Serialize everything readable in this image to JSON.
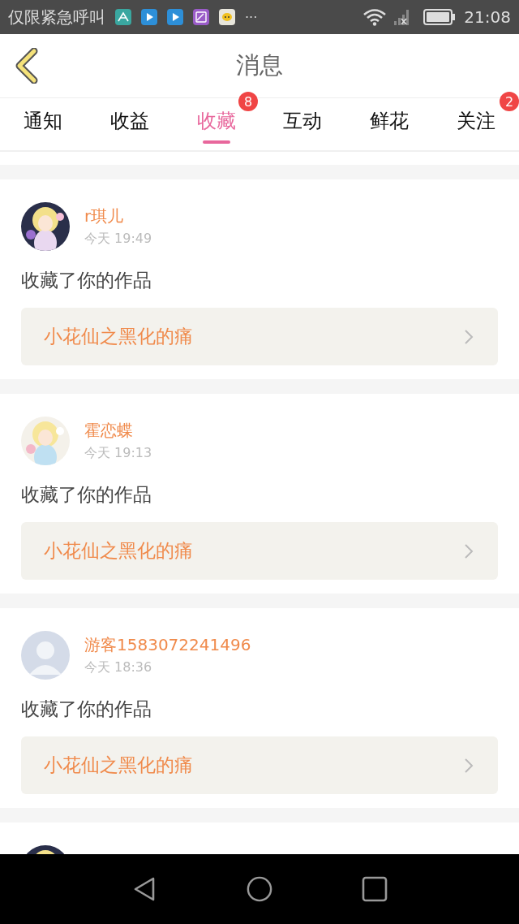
{
  "status_bar": {
    "notice": "仅限紧急呼叫",
    "more": "···",
    "time": "21:08"
  },
  "header": {
    "title": "消息"
  },
  "tabs": [
    {
      "label": "通知",
      "selected": false
    },
    {
      "label": "收益",
      "selected": false
    },
    {
      "label": "收藏",
      "selected": true,
      "badge": "8"
    },
    {
      "label": "互动",
      "selected": false
    },
    {
      "label": "鲜花",
      "selected": false
    },
    {
      "label": "关注",
      "selected": false,
      "badge": "2"
    }
  ],
  "messages": [
    {
      "avatar": {
        "kind": "picture"
      },
      "name": "r琪儿",
      "time": "今天 19:49",
      "action": "收藏了你的作品",
      "work": "小花仙之黑化的痛"
    },
    {
      "avatar": {
        "kind": "picture"
      },
      "name": "霍恋蝶",
      "time": "今天 19:13",
      "action": "收藏了你的作品",
      "work": "小花仙之黑化的痛"
    },
    {
      "avatar": {
        "kind": "default"
      },
      "name": "游客1583072241496",
      "time": "今天 18:36",
      "action": "收藏了你的作品",
      "work": "小花仙之黑化的痛"
    },
    {
      "avatar": {
        "kind": "picture"
      }
    }
  ]
}
